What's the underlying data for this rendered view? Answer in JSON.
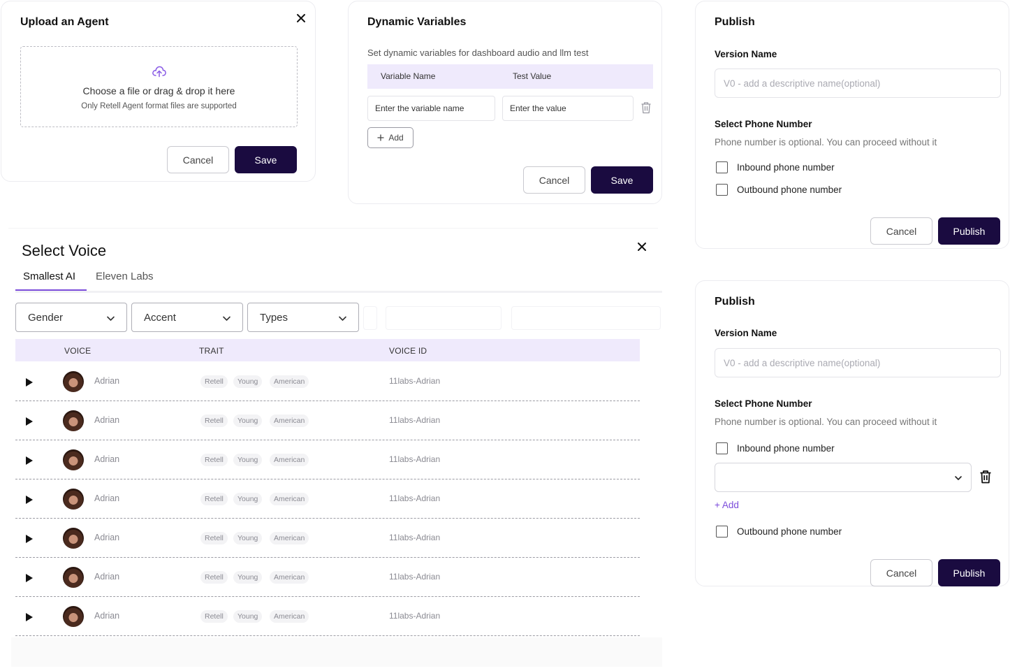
{
  "upload_dialog": {
    "title": "Upload an Agent",
    "dropzone_text": "Choose a file or drag & drop it here",
    "dropzone_subtext": "Only Retell Agent format files are supported",
    "cancel_label": "Cancel",
    "save_label": "Save"
  },
  "dynamic_variables": {
    "title": "Dynamic Variables",
    "description": "Set dynamic variables for dashboard audio and llm test",
    "columns": [
      "Variable Name",
      "Test Value"
    ],
    "variable_placeholder": "Enter the variable name",
    "value_placeholder": "Enter the value",
    "add_label": "Add",
    "cancel_label": "Cancel",
    "save_label": "Save"
  },
  "publish_1": {
    "title": "Publish",
    "version_label": "Version Name",
    "version_placeholder": "V0 - add a descriptive name(optional)",
    "phone_label": "Select Phone Number",
    "phone_hint": "Phone number is optional. You can proceed without it",
    "inbound_label": "Inbound phone number",
    "outbound_label": "Outbound phone number",
    "cancel_label": "Cancel",
    "publish_label": "Publish"
  },
  "publish_2": {
    "title": "Publish",
    "version_label": "Version Name",
    "version_placeholder": "V0 - add a descriptive name(optional)",
    "phone_label": "Select Phone Number",
    "phone_hint": "Phone number is optional. You can proceed without it",
    "inbound_label": "Inbound phone number",
    "add_label": "+ Add",
    "outbound_label": "Outbound phone number",
    "cancel_label": "Cancel",
    "publish_label": "Publish"
  },
  "select_voice": {
    "title": "Select Voice",
    "tabs": [
      "Smallest AI",
      "Eleven Labs"
    ],
    "active_tab": "Smallest AI",
    "filters": [
      "Gender",
      "Accent",
      "Types"
    ],
    "columns": [
      "VOICE",
      "TRAIT",
      "VOICE ID"
    ],
    "rows": [
      {
        "name": "Adrian",
        "traits": [
          "Retell",
          "Young",
          "American"
        ],
        "voice_id": "11labs-Adrian"
      },
      {
        "name": "Adrian",
        "traits": [
          "Retell",
          "Young",
          "American"
        ],
        "voice_id": "11labs-Adrian"
      },
      {
        "name": "Adrian",
        "traits": [
          "Retell",
          "Young",
          "American"
        ],
        "voice_id": "11labs-Adrian"
      },
      {
        "name": "Adrian",
        "traits": [
          "Retell",
          "Young",
          "American"
        ],
        "voice_id": "11labs-Adrian"
      },
      {
        "name": "Adrian",
        "traits": [
          "Retell",
          "Young",
          "American"
        ],
        "voice_id": "11labs-Adrian"
      },
      {
        "name": "Adrian",
        "traits": [
          "Retell",
          "Young",
          "American"
        ],
        "voice_id": "11labs-Adrian"
      },
      {
        "name": "Adrian",
        "traits": [
          "Retell",
          "Young",
          "American"
        ],
        "voice_id": "11labs-Adrian"
      }
    ]
  },
  "colors": {
    "primary": "#1a0b40",
    "accent": "#7c4ddb",
    "table_header": "#efeafc"
  }
}
